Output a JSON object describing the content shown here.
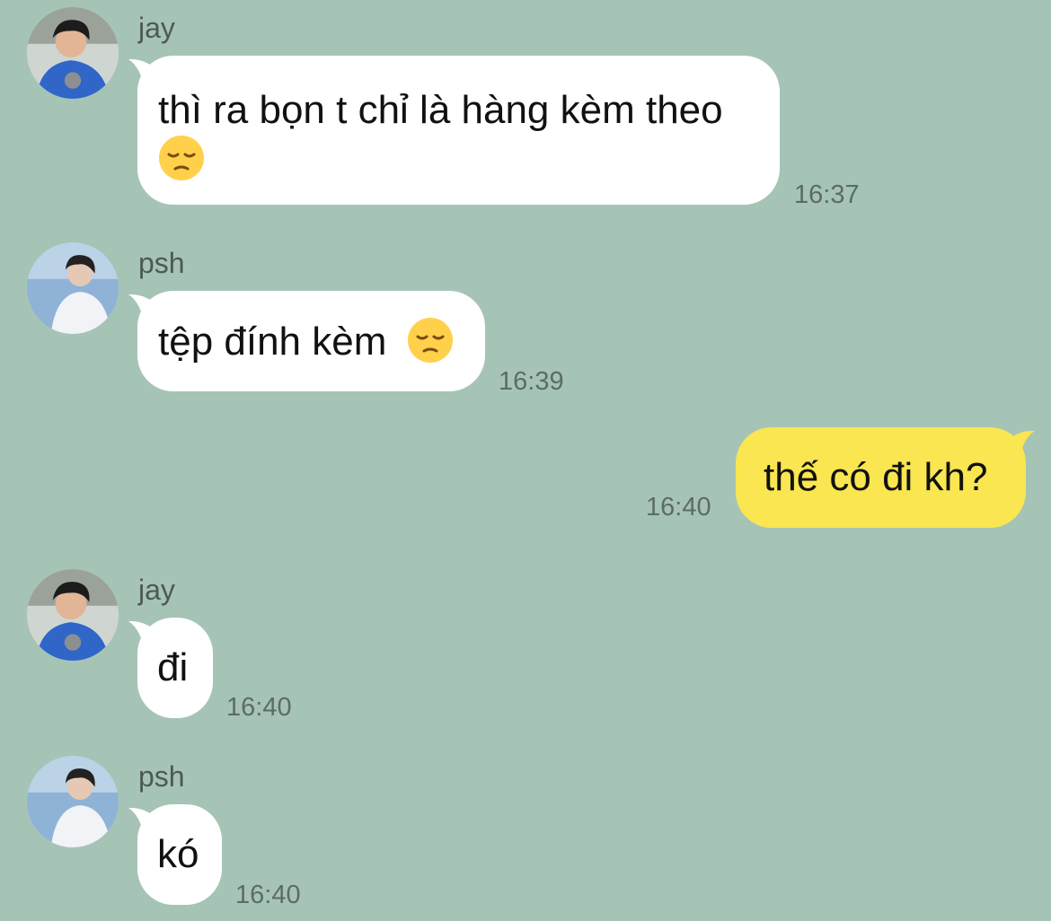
{
  "colors": {
    "background": "#a6c4b6",
    "incoming_bubble": "#ffffff",
    "outgoing_bubble": "#f9e650",
    "sender_text": "#4c5a53",
    "time_text": "#5c6c64"
  },
  "messages": [
    {
      "sender": "jay",
      "text": "thì ra bọn t chỉ là hàng kèm theo",
      "emoji": "pensive-face",
      "time": "16:37",
      "direction": "incoming"
    },
    {
      "sender": "psh",
      "text": "tệp đính kèm",
      "emoji": "pensive-face",
      "time": "16:39",
      "direction": "incoming"
    },
    {
      "sender": "",
      "text": "thế có đi kh?",
      "time": "16:40",
      "direction": "outgoing"
    },
    {
      "sender": "jay",
      "text": "đi",
      "time": "16:40",
      "direction": "incoming"
    },
    {
      "sender": "psh",
      "text": "kó",
      "time": "16:40",
      "direction": "incoming"
    }
  ]
}
